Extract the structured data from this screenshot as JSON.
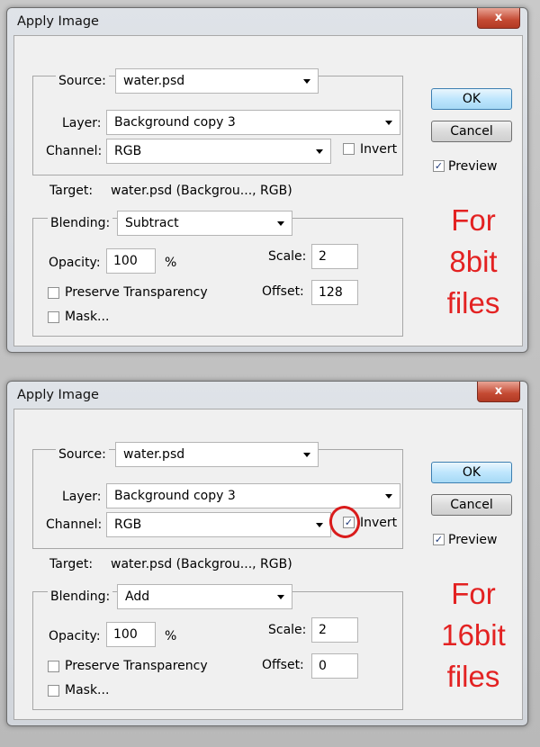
{
  "dialogs": [
    {
      "title": "Apply Image",
      "close_symbol": "x",
      "source_label": "Source:",
      "source_value": "water.psd",
      "layer_label": "Layer:",
      "layer_value": "Background copy 3",
      "channel_label": "Channel:",
      "channel_value": "RGB",
      "invert_label": "Invert",
      "invert_checked": false,
      "target_label": "Target:",
      "target_value": "water.psd (Backgrou..., RGB)",
      "blending_label": "Blending:",
      "blending_value": "Subtract",
      "opacity_label": "Opacity:",
      "opacity_value": "100",
      "opacity_unit": "%",
      "scale_label": "Scale:",
      "scale_value": "2",
      "offset_label": "Offset:",
      "offset_value": "128",
      "preserve_label": "Preserve Transparency",
      "preserve_checked": false,
      "mask_label": "Mask...",
      "mask_checked": false,
      "ok_label": "OK",
      "cancel_label": "Cancel",
      "preview_label": "Preview",
      "preview_checked": true,
      "annotation_line1": "For",
      "annotation_line2": "8bit",
      "annotation_line3": "files"
    },
    {
      "title": "Apply Image",
      "close_symbol": "x",
      "source_label": "Source:",
      "source_value": "water.psd",
      "layer_label": "Layer:",
      "layer_value": "Background copy 3",
      "channel_label": "Channel:",
      "channel_value": "RGB",
      "invert_label": "Invert",
      "invert_checked": true,
      "target_label": "Target:",
      "target_value": "water.psd (Backgrou..., RGB)",
      "blending_label": "Blending:",
      "blending_value": "Add",
      "opacity_label": "Opacity:",
      "opacity_value": "100",
      "opacity_unit": "%",
      "scale_label": "Scale:",
      "scale_value": "2",
      "offset_label": "Offset:",
      "offset_value": "0",
      "preserve_label": "Preserve Transparency",
      "preserve_checked": false,
      "mask_label": "Mask...",
      "mask_checked": false,
      "ok_label": "OK",
      "cancel_label": "Cancel",
      "preview_label": "Preview",
      "preview_checked": true,
      "annotation_line1": "For",
      "annotation_line2": "16bit",
      "annotation_line3": "files"
    }
  ],
  "colors": {
    "annotation": "#e32222",
    "highlight_circle": "#d91b1b"
  }
}
